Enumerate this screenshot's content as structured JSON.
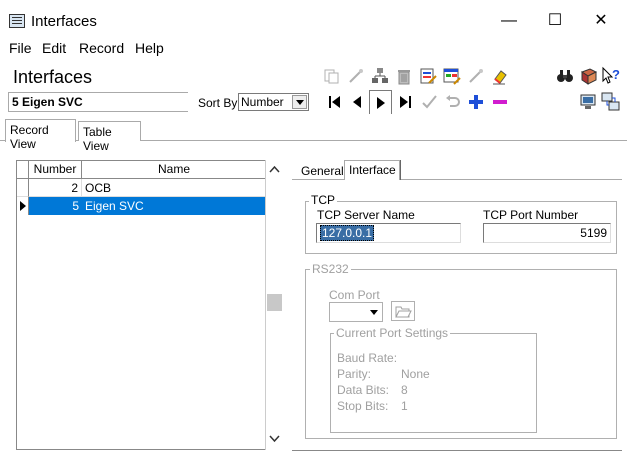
{
  "window": {
    "title": "Interfaces",
    "min_glyph": "—",
    "max_glyph": "☐",
    "close_glyph": "✕"
  },
  "menu": [
    "File",
    "Edit",
    "Record",
    "Help"
  ],
  "form": {
    "title": "Interfaces",
    "current_record": "5 Eigen SVC",
    "sort_by_label": "Sort By",
    "sort_by_value": "Number"
  },
  "tabs": [
    "Record View",
    "Table View"
  ],
  "table": {
    "columns": [
      "Number",
      "Name"
    ],
    "rows": [
      {
        "number": "2",
        "name": "OCB",
        "selected": false
      },
      {
        "number": "5",
        "name": "Eigen SVC",
        "selected": true
      }
    ]
  },
  "detail_tabs": [
    "General",
    "Interface"
  ],
  "tcp": {
    "group_label": "TCP",
    "server_name_label": "TCP Server Name",
    "server_name_value": "127.0.0.1",
    "port_label": "TCP Port Number",
    "port_value": "5199"
  },
  "rs232": {
    "group_label": "RS232",
    "com_port_label": "Com Port",
    "com_port_value": "",
    "current_settings_label": "Current Port Settings",
    "settings": [
      {
        "label": "Baud Rate:",
        "value": ""
      },
      {
        "label": "Parity:",
        "value": "None"
      },
      {
        "label": "Data Bits:",
        "value": "8"
      },
      {
        "label": "Stop Bits:",
        "value": "1"
      }
    ]
  },
  "colors": {
    "selection": "#0078d7",
    "accent_blue": "#1e4fd8",
    "accent_magenta": "#d11ccf"
  }
}
